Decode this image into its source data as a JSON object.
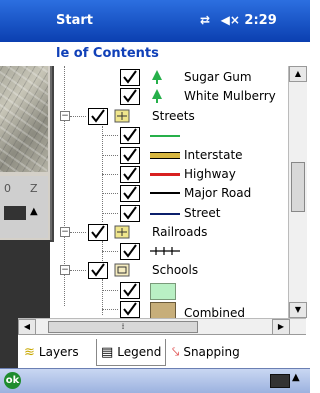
{
  "titlebar": {
    "app": "Start",
    "time": "2:29",
    "conn_icon": "connectivity-icon",
    "vol_icon": "volume-muted-icon"
  },
  "toc": {
    "title": "le of Contents"
  },
  "tree": {
    "items": [
      {
        "label": "Sugar Gum",
        "icon": "tree-icon"
      },
      {
        "label": "White Mulberry",
        "icon": "tree-icon"
      },
      {
        "label": "Streets",
        "icon": "layer-icon"
      },
      {
        "label": "",
        "icon": "line-green"
      },
      {
        "label": "Interstate",
        "icon": "line-interstate"
      },
      {
        "label": "Highway",
        "icon": "line-red"
      },
      {
        "label": "Major Road",
        "icon": "line-black"
      },
      {
        "label": "Street",
        "icon": "line-navy"
      },
      {
        "label": "Railroads",
        "icon": "layer-icon"
      },
      {
        "label": "",
        "icon": "railroad-line"
      },
      {
        "label": "Schools",
        "icon": "polygon-layer-icon"
      },
      {
        "label": "",
        "icon": "swatch-green"
      },
      {
        "label": "Combined",
        "icon": "swatch-tan"
      }
    ]
  },
  "tabs": [
    {
      "label": "Layers",
      "icon": "layers-icon"
    },
    {
      "label": "Legend",
      "icon": "legend-icon"
    },
    {
      "label": "Snapping",
      "icon": "snapping-icon"
    }
  ],
  "bottom": {
    "ok": "ok"
  },
  "mapwin": {
    "key1": "0",
    "key2": "Z"
  },
  "colors": {
    "titlebar": "#1c5bd0",
    "toc_title": "#1040b8",
    "tree_green": "#26b04a",
    "highway": "#d82020",
    "street": "#0b1f6b",
    "swatch_green": "#b9f0c4",
    "swatch_tan": "#c7ae7a"
  }
}
